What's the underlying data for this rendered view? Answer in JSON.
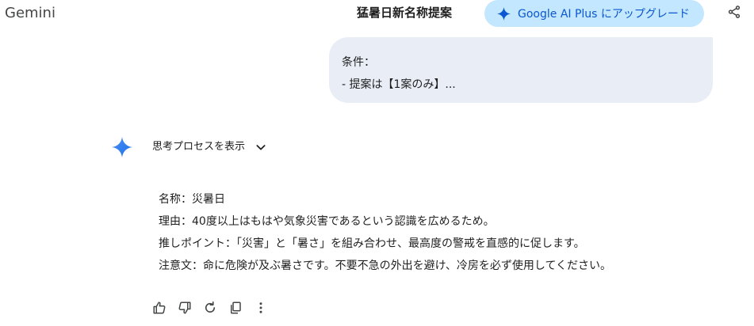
{
  "header": {
    "app_title": "Gemini",
    "chat_title": "猛暑日新名称提案",
    "upgrade_label": "Google AI Plus にアップグレード",
    "accent_color": "#0b57d0",
    "upgrade_bg": "#c2e7ff"
  },
  "user_message": {
    "lines": [
      "条件：",
      "- 提案は【1案のみ】..."
    ]
  },
  "thinking": {
    "label": "思考プロセスを表示"
  },
  "response": {
    "lines": [
      "名称：災暑日",
      "理由：40度以上はもはや気象災害であるという認識を広めるため。",
      "推しポイント：「災害」と「暑さ」を組み合わせ、最高度の警戒を直感的に促します。",
      "注意文：命に危険が及ぶ暑さです。不要不急の外出を避け、冷房を必ず使用してください。"
    ]
  },
  "icons": {
    "share": "share-icon",
    "spark": "gemini-spark-icon",
    "thumbs_up": "thumbs-up-icon",
    "thumbs_down": "thumbs-down-icon",
    "regenerate": "regenerate-icon",
    "copy": "copy-icon",
    "more": "more-vertical-icon"
  }
}
